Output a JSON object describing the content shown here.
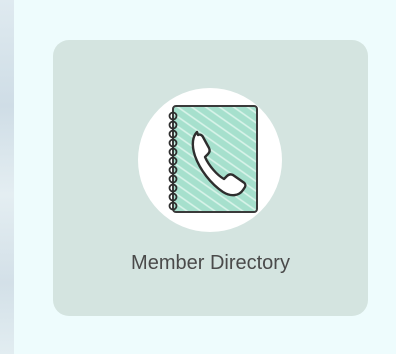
{
  "tile": {
    "label": "Member Directory",
    "icon": "phone-book-icon",
    "colors": {
      "page_bg": "#eefcfd",
      "tile_bg": "#d4e4e0",
      "icon_circle": "#ffffff",
      "notebook_fill": "#9fdcc7",
      "notebook_stroke": "#3a3a3a",
      "label_color": "#4a4a4a"
    }
  }
}
